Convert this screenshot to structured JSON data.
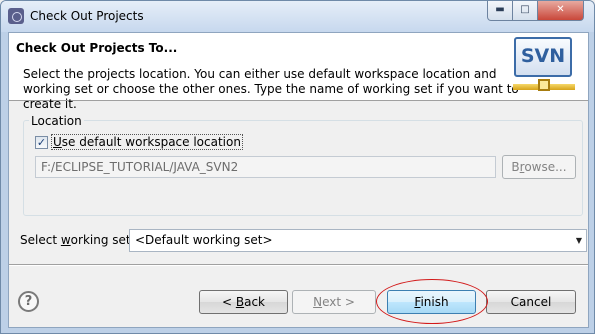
{
  "window": {
    "title": "Check Out Projects",
    "min_glyph": "▬",
    "max_glyph": "□",
    "close_glyph": "✕"
  },
  "banner": {
    "title": "Check Out Projects To...",
    "description": "Select the projects location. You can either use default workspace location and working set or choose the other ones. Type the name of working set if you want to create it.",
    "logo_text": "SVN"
  },
  "location": {
    "group_label": "Location",
    "use_default_label": "Use default workspace location",
    "use_default_checked": true,
    "check_glyph": "✓",
    "path_value": "F:/ECLIPSE_TUTORIAL/JAVA_SVN2",
    "browse_label": "Browse..."
  },
  "working_set": {
    "label": "Select working set:",
    "value": "<Default working set>",
    "arrow_glyph": "▼"
  },
  "footer": {
    "help_glyph": "?",
    "back_label": "< Back",
    "next_label": "Next >",
    "finish_label": "Finish",
    "cancel_label": "Cancel"
  },
  "colors": {
    "annotation": "#d21a1a",
    "finish_border": "#3c7fb1"
  }
}
